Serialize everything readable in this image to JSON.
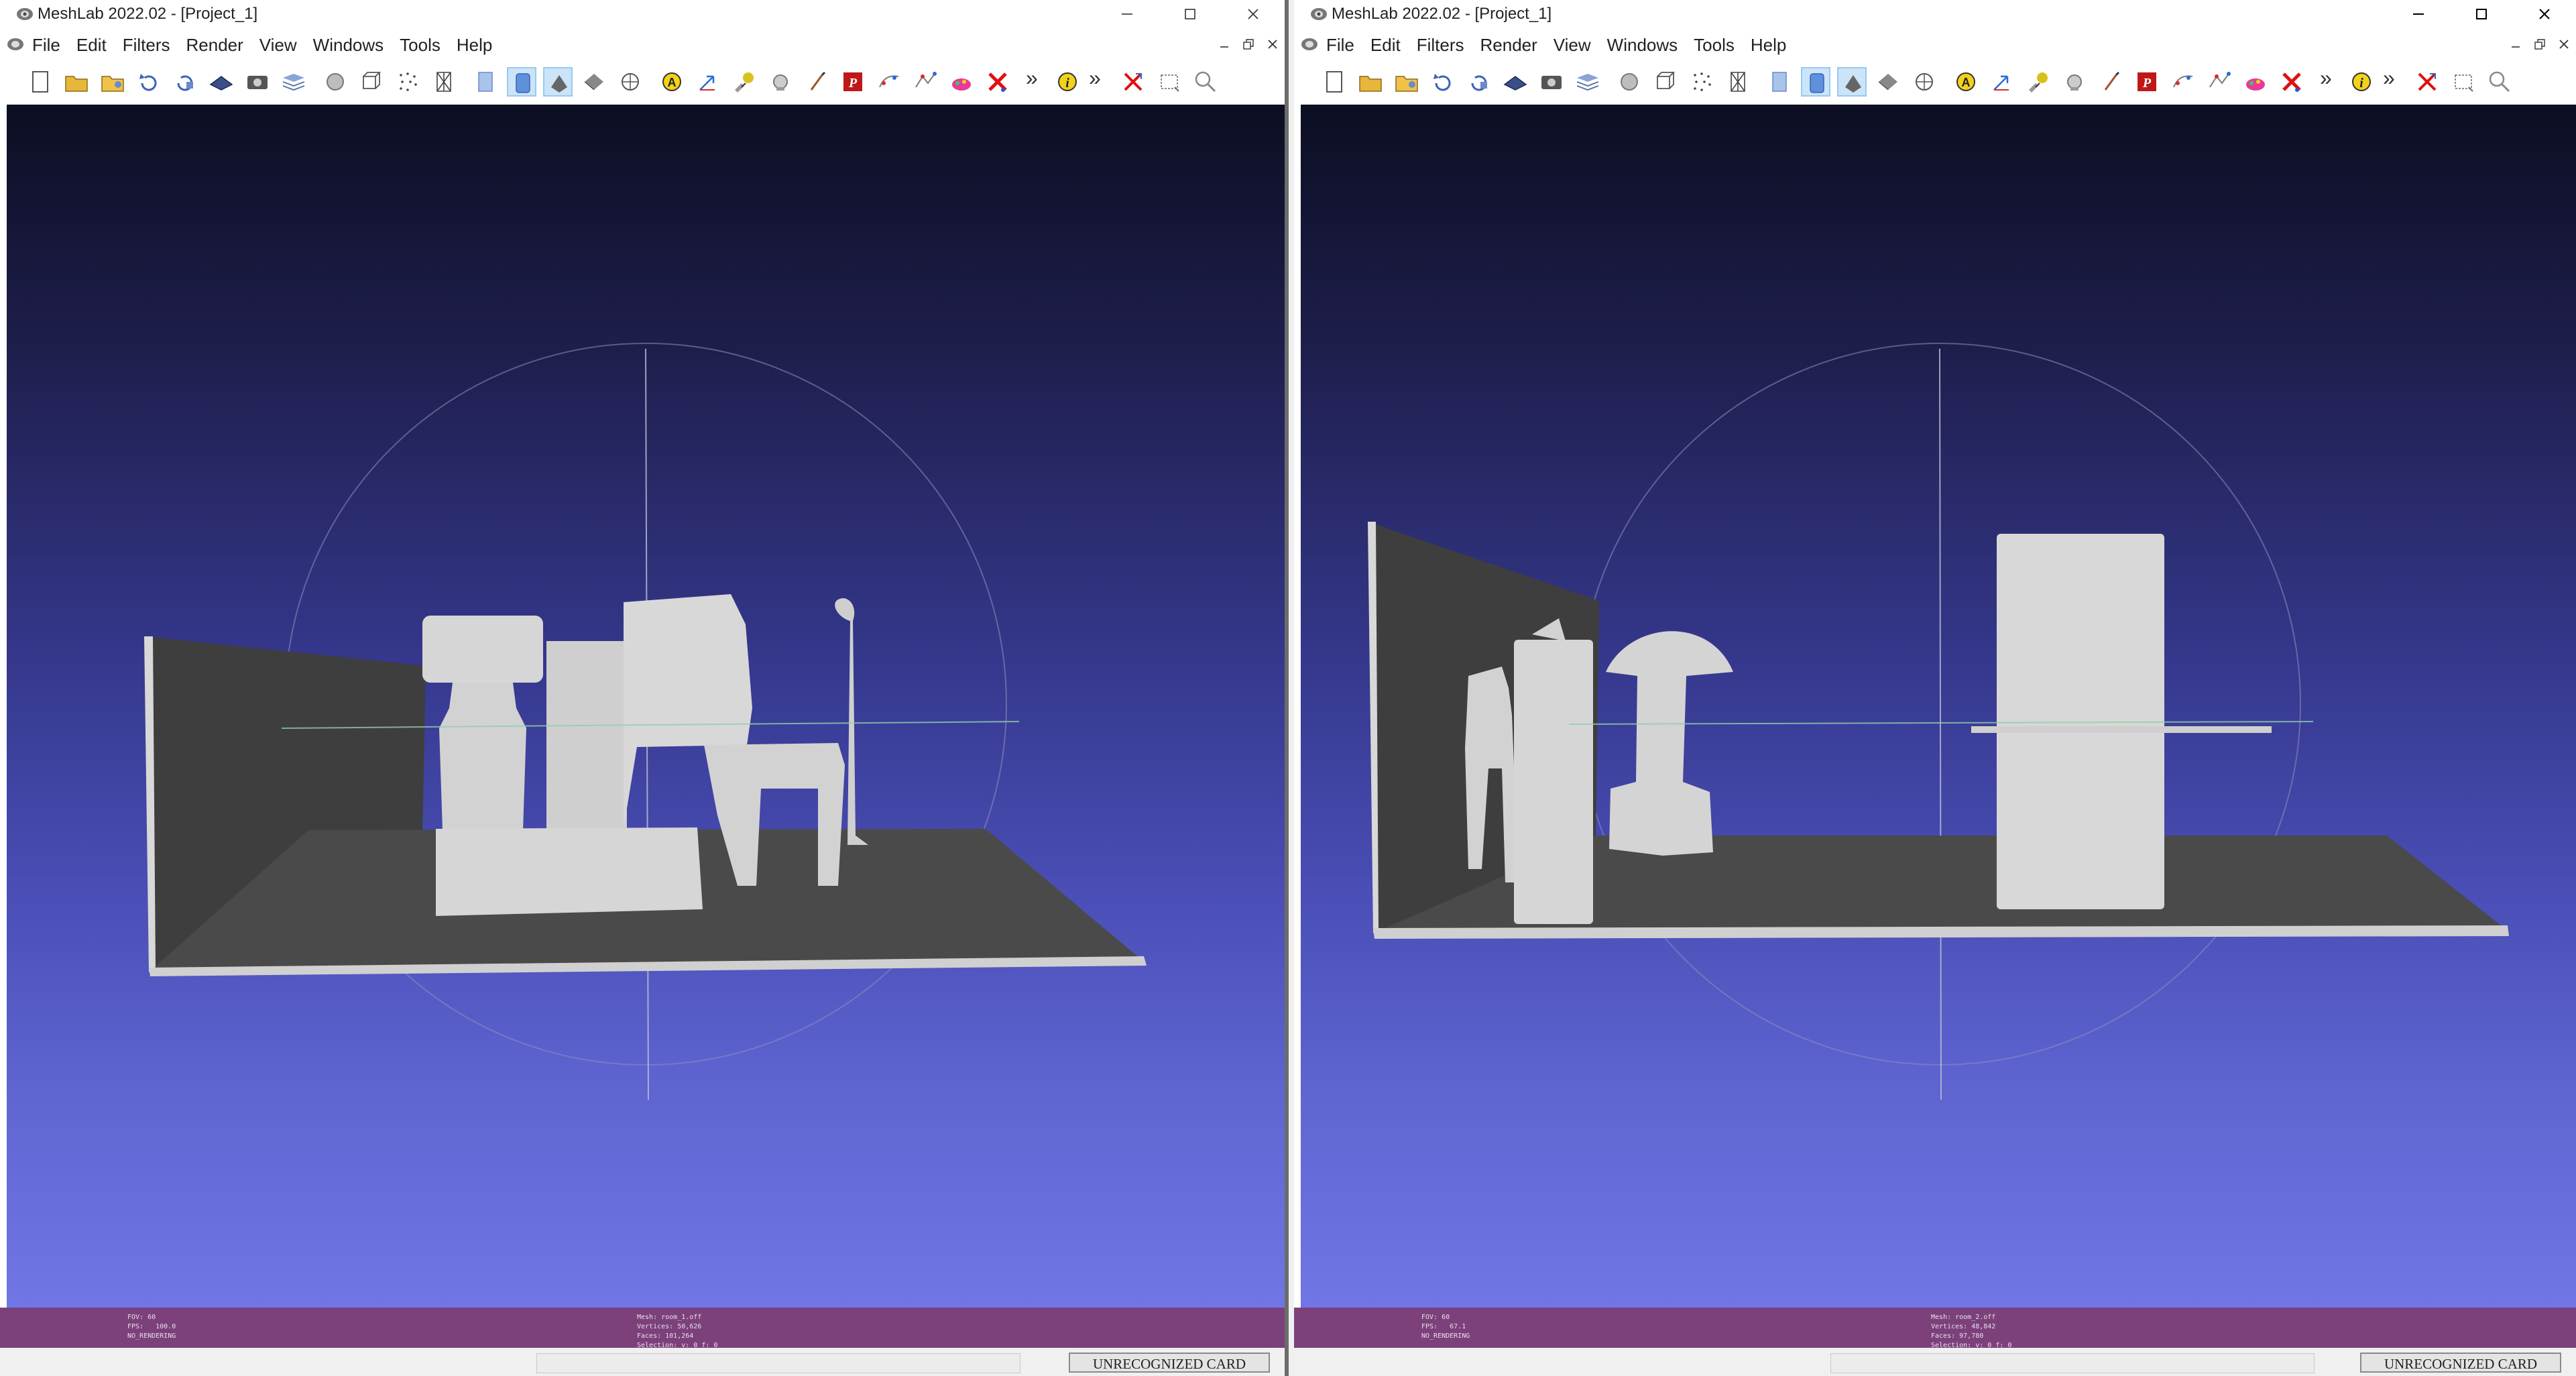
{
  "windows": [
    {
      "title": "MeshLab 2022.02 - [Project_1]",
      "menus": [
        "File",
        "Edit",
        "Filters",
        "Render",
        "View",
        "Windows",
        "Tools",
        "Help"
      ],
      "info_left": [
        "FOV: 60",
        "FPS:   100.0",
        "NO_RENDERING"
      ],
      "info_right": [
        "Mesh: room_1.off",
        "Vertices: 50,626",
        "Faces: 101,264",
        "Selection: v: 0 f: 0"
      ],
      "status_card": "UNRECOGNIZED CARD"
    },
    {
      "title": "MeshLab 2022.02 - [Project_1]",
      "menus": [
        "File",
        "Edit",
        "Filters",
        "Render",
        "View",
        "Windows",
        "Tools",
        "Help"
      ],
      "info_left": [
        "FOV: 60",
        "FPS:   67.1",
        "NO_RENDERING"
      ],
      "info_right": [
        "Mesh: room_2.off",
        "Vertices: 48,842",
        "Faces: 97,780",
        "Selection: v: 0 f: 0"
      ],
      "status_card": "UNRECOGNIZED CARD"
    }
  ],
  "toolbar_icons": [
    "new-project-icon",
    "open-project-icon",
    "open-mesh-icon",
    "reload-icon",
    "reload-all-icon",
    "save-mesh-icon",
    "snapshot-icon",
    "layers-icon",
    "raster-icon",
    "bbox-icon",
    "points-icon",
    "wireframe-icon",
    "flat-icon",
    "smooth-icon",
    "fill-icon",
    "texture-icon",
    "color-icon",
    "light-icon",
    "trackball-icon",
    "annotation-icon",
    "measure-icon",
    "select-faces-icon",
    "align-icon",
    "paint-icon",
    "pick-points-icon",
    "manipulator-icon",
    "mutual-info-icon",
    "color-paint-icon",
    "delete-icon",
    "info-icon",
    "zoom-region-icon"
  ],
  "colors": {
    "info_bar": "#7c417b",
    "viewport_top": "#0c0e22",
    "viewport_bottom": "#7177e6"
  }
}
